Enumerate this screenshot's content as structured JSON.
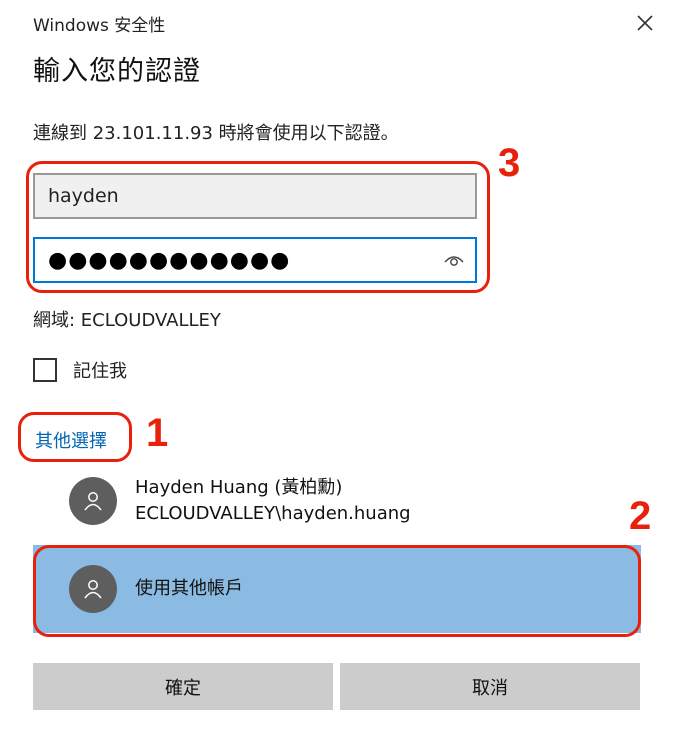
{
  "window": {
    "title": "Windows 安全性"
  },
  "heading": "輸入您的認證",
  "description": "連線到 23.101.11.93 時將會使用以下認證。",
  "credentials": {
    "username_value": "hayden",
    "password_masked": "●●●●●●●●●●●●"
  },
  "domain_text": "網域: ECLOUDVALLEY",
  "remember": {
    "label": "記住我",
    "checked": false
  },
  "more_choices_label": "其他選擇",
  "accounts": [
    {
      "name": "Hayden Huang (黃柏勳)",
      "id": "ECLOUDVALLEY\\hayden.huang"
    },
    {
      "name": "使用其他帳戶"
    }
  ],
  "buttons": {
    "ok_label": "確定",
    "cancel_label": "取消"
  },
  "annotations": {
    "callout_1": "1",
    "callout_2": "2",
    "callout_3": "3",
    "color": "#e8210c"
  },
  "colors": {
    "selected_account_bg": "#8bbbe3",
    "focus_border": "#0078d7",
    "link": "#0066b4",
    "button_bg": "#cccccc"
  }
}
